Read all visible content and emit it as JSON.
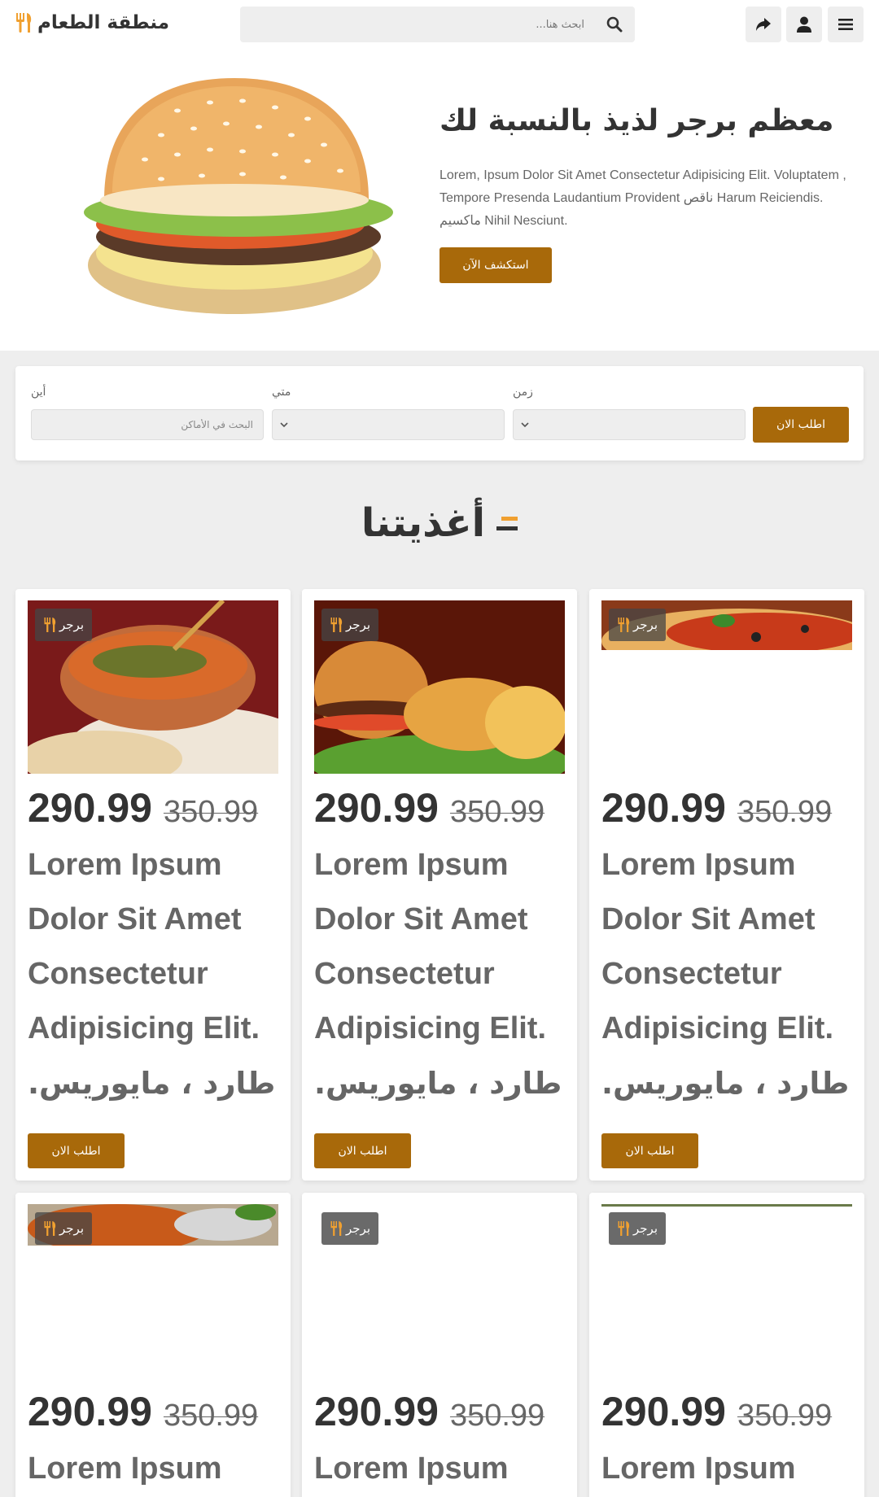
{
  "header": {
    "logo_text": "منطقة الطعام",
    "search_placeholder": "ابحث هنا...",
    "icons": [
      "fork-knife-icon",
      "search-icon",
      "share-icon",
      "user-icon",
      "menu-icon"
    ]
  },
  "hero": {
    "title": "معظم برجر لذيذ بالنسبة لك",
    "text": "Lorem, Ipsum Dolor Sit Amet Consectetur Adipisicing Elit. Voluptatem , Tempore Presenda Laudantium Provident ناقص Harum Reiciendis. ماكسيم Nihil Nesciunt.",
    "button": "استكشف الآن"
  },
  "booking": {
    "where_label": "أين",
    "where_placeholder": "البحث في الأماكن",
    "when_label": "متي",
    "time_label": "زمن",
    "button": "اطلب الان"
  },
  "section": {
    "title": "أغذيتنا"
  },
  "colors": {
    "accent": "#a8690a",
    "badge_icon": "#f0a030"
  },
  "cards": [
    {
      "badge": "برجر",
      "price": "290.99",
      "old_price": "350.99",
      "desc": "Lorem Ipsum Dolor Sit Amet Consectetur Adipisicing Elit.",
      "desc_ar": "طارد ، مايوريس.",
      "button": "اطلب الان"
    },
    {
      "badge": "برجر",
      "price": "290.99",
      "old_price": "350.99",
      "desc": "Lorem Ipsum Dolor Sit Amet Consectetur Adipisicing Elit.",
      "desc_ar": "طارد ، مايوريس.",
      "button": "اطلب الان"
    },
    {
      "badge": "برجر",
      "price": "290.99",
      "old_price": "350.99",
      "desc": "Lorem Ipsum Dolor Sit Amet Consectetur Adipisicing Elit.",
      "desc_ar": "طارد ، مايوريس.",
      "button": "اطلب الان"
    },
    {
      "badge": "برجر",
      "price": "290.99",
      "old_price": "350.99",
      "desc": "Lorem Ipsum"
    },
    {
      "badge": "برجر",
      "price": "290.99",
      "old_price": "350.99",
      "desc": "Lorem Ipsum"
    },
    {
      "badge": "برجر",
      "price": "290.99",
      "old_price": "350.99",
      "desc": "Lorem Ipsum"
    }
  ]
}
